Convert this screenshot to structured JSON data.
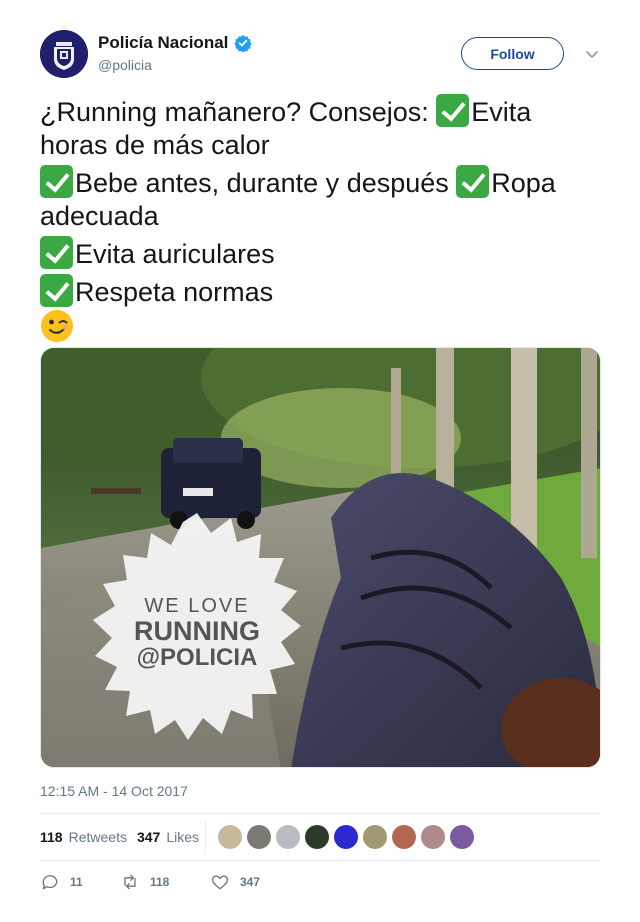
{
  "account": {
    "display_name": "Policía Nacional",
    "handle": "@policia",
    "verified": true,
    "avatar_icon": "policia-shield-logo-icon"
  },
  "follow_button": {
    "label": "Follow"
  },
  "more_menu": {
    "icon": "chevron-down-icon"
  },
  "tweet": {
    "line1_text": "¿Running mañanero? Consejos: ",
    "line1_tail": "Evita horas de más calor",
    "line2_a": "Bebe antes, durante y después ",
    "line2_b": "Ropa adecuada",
    "line3": "Evita auriculares",
    "line4": "Respeta normas",
    "check_emoji": "white-heavy-check-mark-icon",
    "wink_emoji": "winking-face-icon"
  },
  "media": {
    "overlay_line1": "WE LOVE",
    "overlay_line2": "RUNNING",
    "overlay_line3": "@POLICIA"
  },
  "timestamp": "12:15 AM - 14 Oct 2017",
  "stats": {
    "retweets_count": "118",
    "retweets_label": "Retweets",
    "likes_count": "347",
    "likes_label": "Likes"
  },
  "likers": [
    "#c8b89a",
    "#7a7a72",
    "#b7bcc2",
    "#2d3a2a",
    "#2a2ad0",
    "#a09a72",
    "#b06850",
    "#b08a8a",
    "#7a5aa0"
  ],
  "actions": {
    "reply_count": "11",
    "retweet_count": "118",
    "like_count": "347"
  },
  "colors": {
    "follow_blue": "#1b4a9c",
    "verified_blue": "#1da1f2",
    "check_green": "#3aa843",
    "muted_text": "#657786"
  }
}
